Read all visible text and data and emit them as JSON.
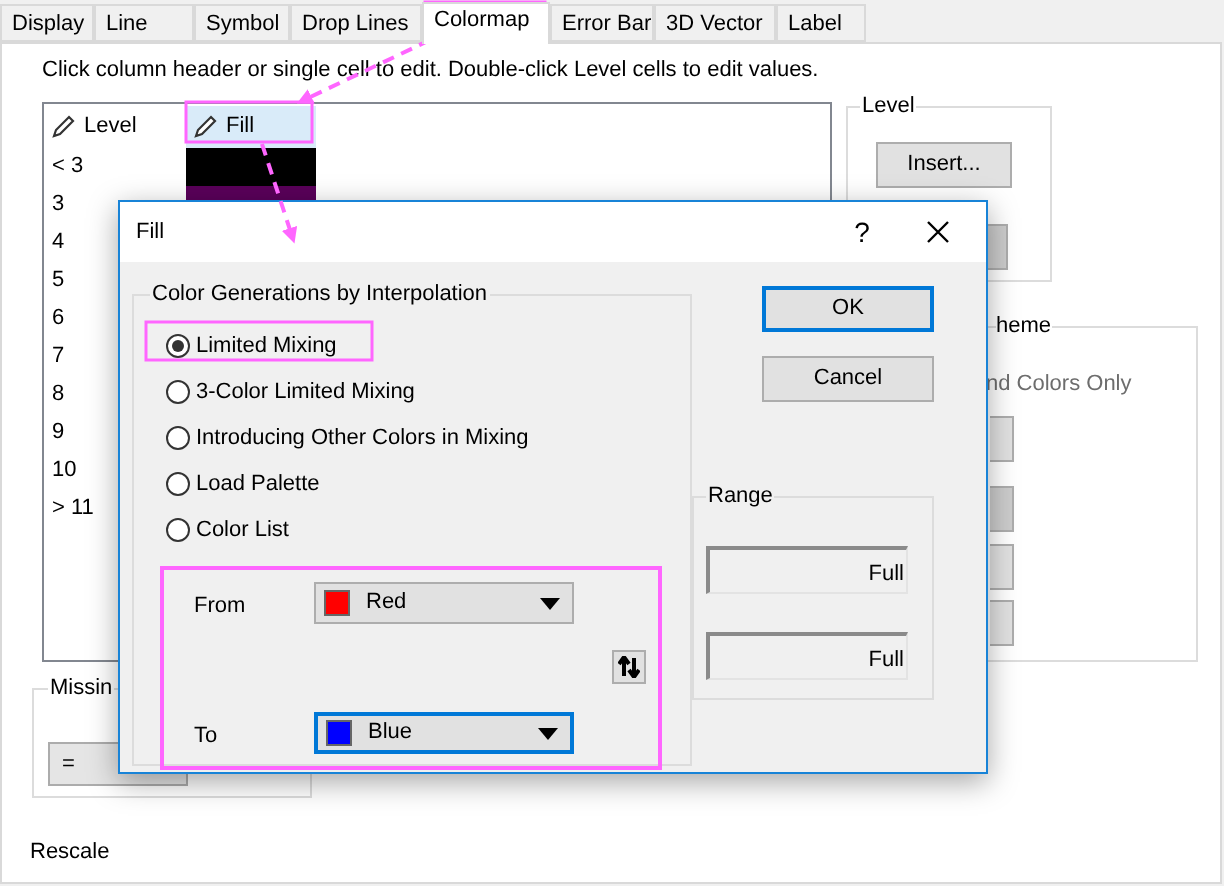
{
  "tabs": [
    {
      "label": "Display",
      "selected": false
    },
    {
      "label": "Line",
      "selected": false
    },
    {
      "label": "Symbol",
      "selected": false
    },
    {
      "label": "Drop Lines",
      "selected": false
    },
    {
      "label": "Colormap",
      "selected": true
    },
    {
      "label": "Error Bar",
      "selected": false
    },
    {
      "label": "3D Vector",
      "selected": false
    },
    {
      "label": "Label",
      "selected": false
    }
  ],
  "instruction": "Click column header or single cell to edit. Double-click Level cells to edit values.",
  "color_table": {
    "columns": [
      "Level",
      "Fill"
    ],
    "rows": [
      {
        "level": "< 3",
        "color": "#000000"
      },
      {
        "level": "3",
        "color": "#5a005a"
      },
      {
        "level": "4"
      },
      {
        "level": "5"
      },
      {
        "level": "6"
      },
      {
        "level": "7"
      },
      {
        "level": "8"
      },
      {
        "level": "9"
      },
      {
        "level": "10"
      },
      {
        "level": "> 11"
      }
    ]
  },
  "level_group": {
    "title": "Level",
    "buttons": [
      "Insert..."
    ]
  },
  "theme_group": {
    "title": "heme",
    "option": "nd Colors Only"
  },
  "missing_group": {
    "title": "Missin",
    "dropdown": "="
  },
  "rescale_label": "Rescale",
  "dialog": {
    "title": "Fill",
    "help": "?",
    "interpolation_group": {
      "title": "Color Generations by Interpolation",
      "options": [
        {
          "label": "Limited Mixing",
          "selected": true
        },
        {
          "label": "3-Color Limited Mixing",
          "selected": false
        },
        {
          "label": "Introducing Other Colors in Mixing",
          "selected": false
        },
        {
          "label": "Load Palette",
          "selected": false
        },
        {
          "label": "Color List",
          "selected": false
        }
      ]
    },
    "from": {
      "label": "From",
      "value": "Red",
      "color": "#ff0000",
      "focused": false
    },
    "to": {
      "label": "To",
      "value": "Blue",
      "color": "#0000ff",
      "focused": true
    },
    "buttons": [
      {
        "label": "OK",
        "default": true
      },
      {
        "label": "Cancel",
        "default": false
      }
    ],
    "range": {
      "title": "Range",
      "fields": [
        "Full",
        "Full"
      ]
    }
  }
}
